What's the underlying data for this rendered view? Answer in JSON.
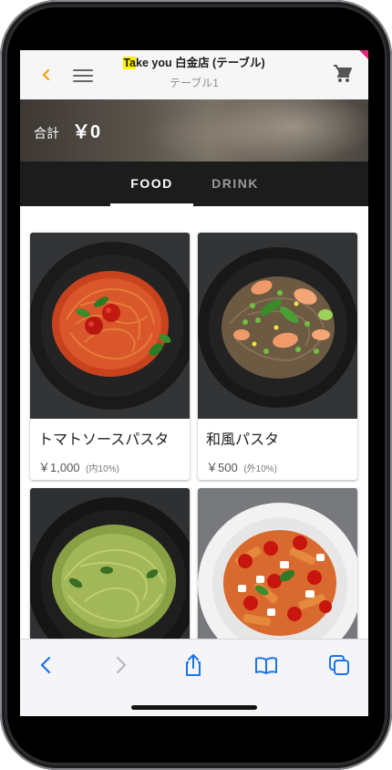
{
  "header": {
    "store_title_highlight": "Ta",
    "store_title_rest": "ke you 白金店 (テーブル)",
    "table_name": "テーブル1",
    "accent_color": "#f0a500"
  },
  "summary": {
    "total_label": "合計",
    "total_value": "￥0"
  },
  "tabs": [
    {
      "label": "FOOD",
      "selected": true
    },
    {
      "label": "DRINK",
      "selected": false
    }
  ],
  "menu_items": [
    {
      "name": "トマトソースパスタ",
      "price": "￥1,000",
      "tax": "(内10%)",
      "icon": "tomato-pasta-photo"
    },
    {
      "name": "和風パスタ",
      "price": "￥500",
      "tax": "(外10%)",
      "icon": "japanese-pasta-photo"
    },
    {
      "name": "",
      "price": "",
      "tax": "",
      "icon": "pesto-pasta-photo"
    },
    {
      "name": "",
      "price": "",
      "tax": "",
      "icon": "penne-pasta-photo"
    }
  ],
  "toolbar": {
    "icons": [
      "back-icon",
      "forward-icon",
      "share-icon",
      "bookmarks-icon",
      "tabs-icon"
    ],
    "tint_color": "#1a73e8"
  }
}
